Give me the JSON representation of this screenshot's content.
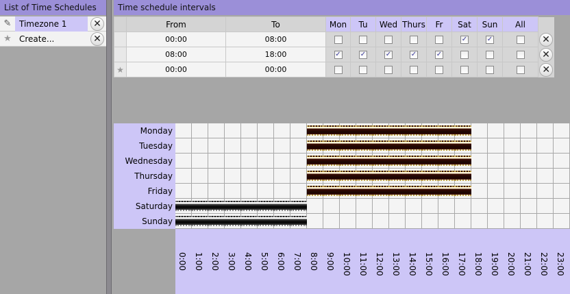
{
  "left": {
    "title": "List of Time Schedules",
    "items": [
      {
        "label": "Timezone 1",
        "icon": "pencil-icon",
        "selected": true
      },
      {
        "label": "Create...",
        "icon": "star-icon",
        "selected": false
      }
    ]
  },
  "right": {
    "title": "Time schedule intervals",
    "columns": {
      "from": "From",
      "to": "To",
      "days": [
        "Mon",
        "Tu",
        "Wed",
        "Thurs",
        "Fr",
        "Sat",
        "Sun",
        "All"
      ]
    },
    "intervals": [
      {
        "from": "00:00",
        "to": "08:00",
        "checked": [
          false,
          false,
          false,
          false,
          false,
          true,
          true,
          false
        ],
        "new": false
      },
      {
        "from": "08:00",
        "to": "18:00",
        "checked": [
          true,
          true,
          true,
          true,
          true,
          false,
          false,
          false
        ],
        "new": false
      },
      {
        "from": "00:00",
        "to": "00:00",
        "checked": [
          false,
          false,
          false,
          false,
          false,
          false,
          false,
          false
        ],
        "new": true
      }
    ]
  },
  "schedule": {
    "days": [
      "Monday",
      "Tuesday",
      "Wednesday",
      "Thursday",
      "Friday",
      "Saturday",
      "Sunday"
    ],
    "hours": [
      "0:00",
      "1:00",
      "2:00",
      "3:00",
      "4:00",
      "5:00",
      "6:00",
      "7:00",
      "8:00",
      "9:00",
      "10:00",
      "11:00",
      "12:00",
      "13:00",
      "14:00",
      "15:00",
      "16:00",
      "17:00",
      "18:00",
      "19:00",
      "20:00",
      "21:00",
      "22:00",
      "23:00"
    ],
    "ranges": [
      {
        "days": [
          0,
          1,
          2,
          3,
          4
        ],
        "start": 8,
        "end": 18,
        "style": "wd"
      },
      {
        "days": [
          5,
          6
        ],
        "start": 0,
        "end": 8,
        "style": "we"
      }
    ]
  }
}
